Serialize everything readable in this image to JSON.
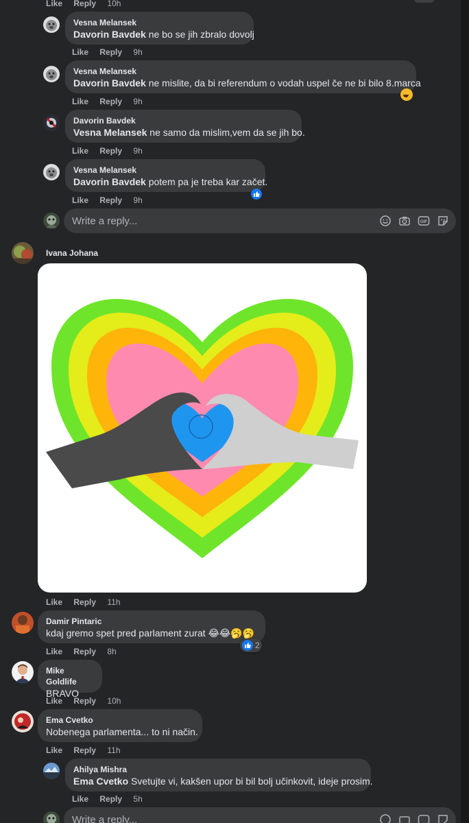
{
  "reply_placeholder": "Write a reply...",
  "actions": {
    "like": "Like",
    "reply": "Reply"
  },
  "top_partial": {
    "time": "10h"
  },
  "replies": [
    {
      "author": "Vesna Melansek",
      "mention": "Davorin Bavdek",
      "text": " ne bo se jih zbralo dovolj",
      "time": "9h"
    },
    {
      "author": "Vesna Melansek",
      "mention": "Davorin Bavdek",
      "text": " ne mislite, da bi referendum o vodah uspel če ne bi bilo 8.marca",
      "time": "9h"
    },
    {
      "author": "Davorin Bavdek",
      "mention": "Vesna Melansek",
      "text": " ne samo da mislim,vem da se jih bo.",
      "time": "9h"
    },
    {
      "author": "Vesna Melansek",
      "mention": "Davorin Bavdek",
      "text": " potem pa je treba kar začet.",
      "time": "9h"
    }
  ],
  "comments": [
    {
      "author": "Ivana Johana",
      "time": "11h"
    },
    {
      "author": "Damir Pintaric",
      "text": "kdaj gremo spet pred parlament zurat 😂😂🥱🥱",
      "time": "8h",
      "reaction_count": "2"
    },
    {
      "author": "Mike Goldlife",
      "text": "BRAVO",
      "time": "10h"
    },
    {
      "author": "Ema Cvetko",
      "text": "Nobenega parlamenta... to ni način.",
      "time": "11h"
    }
  ],
  "nested_reply": {
    "author": "Ahilya Mishra",
    "mention": "Ema Cvetko",
    "text": " Svetujte vi, kakšen upor bi bil bolj učinkovit, ideje prosim.",
    "time": "5h"
  },
  "reply_box_icons": [
    "emoji-icon",
    "camera-icon",
    "gif-icon",
    "sticker-icon"
  ],
  "colors": {
    "bg": "#242526",
    "bubble": "#3a3b3c",
    "text": "#e4e6eb",
    "muted": "#b0b3b8",
    "like_blue": "#1877f2"
  }
}
